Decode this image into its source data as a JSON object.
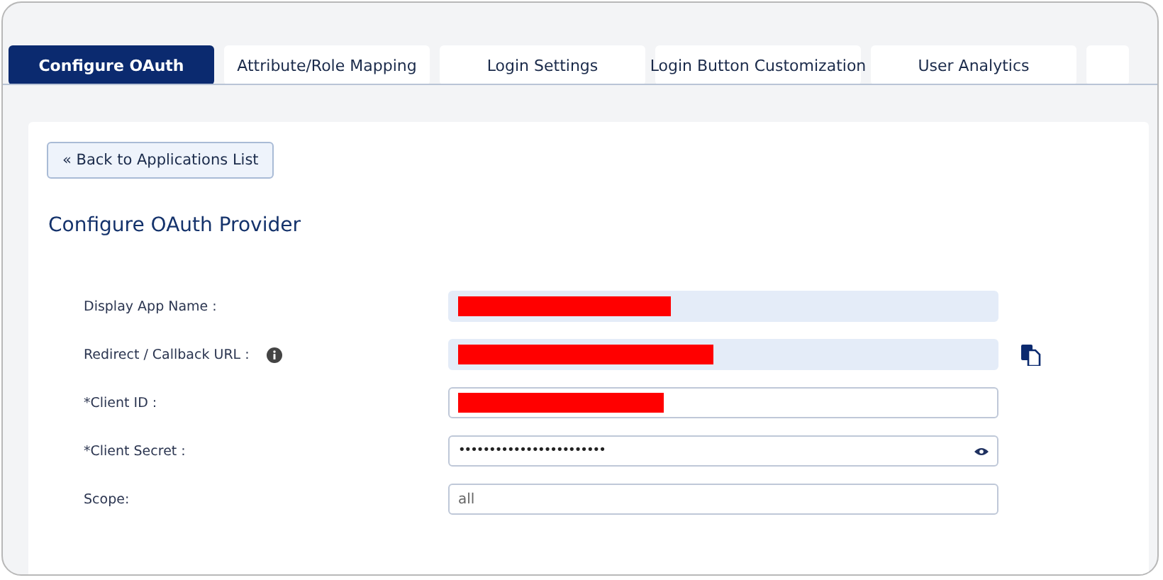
{
  "tabs": [
    {
      "label": "Configure OAuth",
      "selected": true
    },
    {
      "label": "Attribute/Role Mapping",
      "selected": false
    },
    {
      "label": "Login Settings",
      "selected": false
    },
    {
      "label": "Login Button Customization",
      "selected": false
    },
    {
      "label": "User Analytics",
      "selected": false
    }
  ],
  "back_button": "« Back to Applications List",
  "heading": "Configure OAuth Provider",
  "fields": [
    {
      "label": "Display App Name :",
      "kind": "redacted",
      "readonly": true
    },
    {
      "label": "Redirect / Callback URL :",
      "kind": "redacted",
      "readonly": true,
      "info": true,
      "copy": true
    },
    {
      "label": "*Client ID :",
      "kind": "redacted",
      "readonly": false
    },
    {
      "label": "*Client Secret :",
      "kind": "password",
      "value": "••••••••••••••••••••••••",
      "readonly": false,
      "reveal": true
    },
    {
      "label": "Scope:",
      "kind": "text",
      "value": "all",
      "readonly": false
    }
  ]
}
